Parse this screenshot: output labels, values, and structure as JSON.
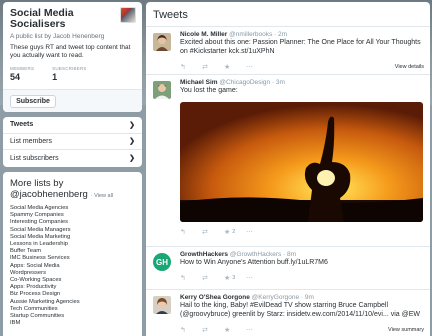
{
  "list": {
    "title": "Social Media Socialisers",
    "byline": "A public list by Jacob Henenberg",
    "description": "These guys RT and tweet top content that you actually want to read.",
    "members_label": "MEMBERS",
    "members_value": "54",
    "subscribers_label": "SUBSCRIBERS",
    "subscribers_value": "1",
    "subscribe_label": "Subscribe"
  },
  "nav": {
    "items": [
      {
        "label": "Tweets"
      },
      {
        "label": "List members"
      },
      {
        "label": "List subscribers"
      }
    ]
  },
  "more_lists": {
    "title": "More lists by",
    "handle": "@jacobhenenberg",
    "view_all": "· View all",
    "items": [
      "Social Media Agencies",
      "Spammy Companies",
      "Interesting Companies",
      "Social Media Managers",
      "Social Media Marketing",
      "Lessons in Leadership",
      "Buffer Team",
      "IMC Business Services",
      "Apps: Social Media",
      "Wordpressers",
      "Co-Working Spaces",
      "Apps: Productivity",
      "Biz Process Design",
      "Aussie Marketing Agencies",
      "Tech Communities",
      "Startup Communities",
      "IBM"
    ]
  },
  "tweets": {
    "header": "Tweets",
    "items": [
      {
        "name": "Nicole M. Miller",
        "handle": "@nmillerbooks",
        "time": "· 2m",
        "text": "Excited about this one: Passion Planner: The One Place for All Your Thoughts on #Kickstarter kck.st/1uXPhN",
        "link": "View details",
        "retweets": "",
        "favorites": ""
      },
      {
        "name": "Michael Sim",
        "handle": "@ChicagoDesign",
        "time": "· 3m",
        "text": "You lost the game:",
        "link": "",
        "retweets": "",
        "favorites": "2"
      },
      {
        "name": "GrowthHackers",
        "handle": "@GrowthHackers",
        "time": "· 8m",
        "text": "How to Win Anyone's Attention buff.ly/1uLR7M6",
        "link": "",
        "retweets": "",
        "favorites": "3"
      },
      {
        "name": "Kerry O'Shea Gorgone",
        "handle": "@KerryGorgone",
        "time": "· 9m",
        "text": "Hail to the king, Baby! #EvilDead TV show starring Bruce Campbell (@groovybruce) greenlit by Starz: insidetv.ew.com/2014/11/10/evi... via @EW",
        "link": "View summary",
        "retweets": "",
        "favorites": ""
      }
    ]
  },
  "colors": {
    "background": "#8c9aa3",
    "card": "#ffffff",
    "text": "#292f33",
    "muted": "#8899a6",
    "growthhackers_brand": "#1aa776"
  }
}
